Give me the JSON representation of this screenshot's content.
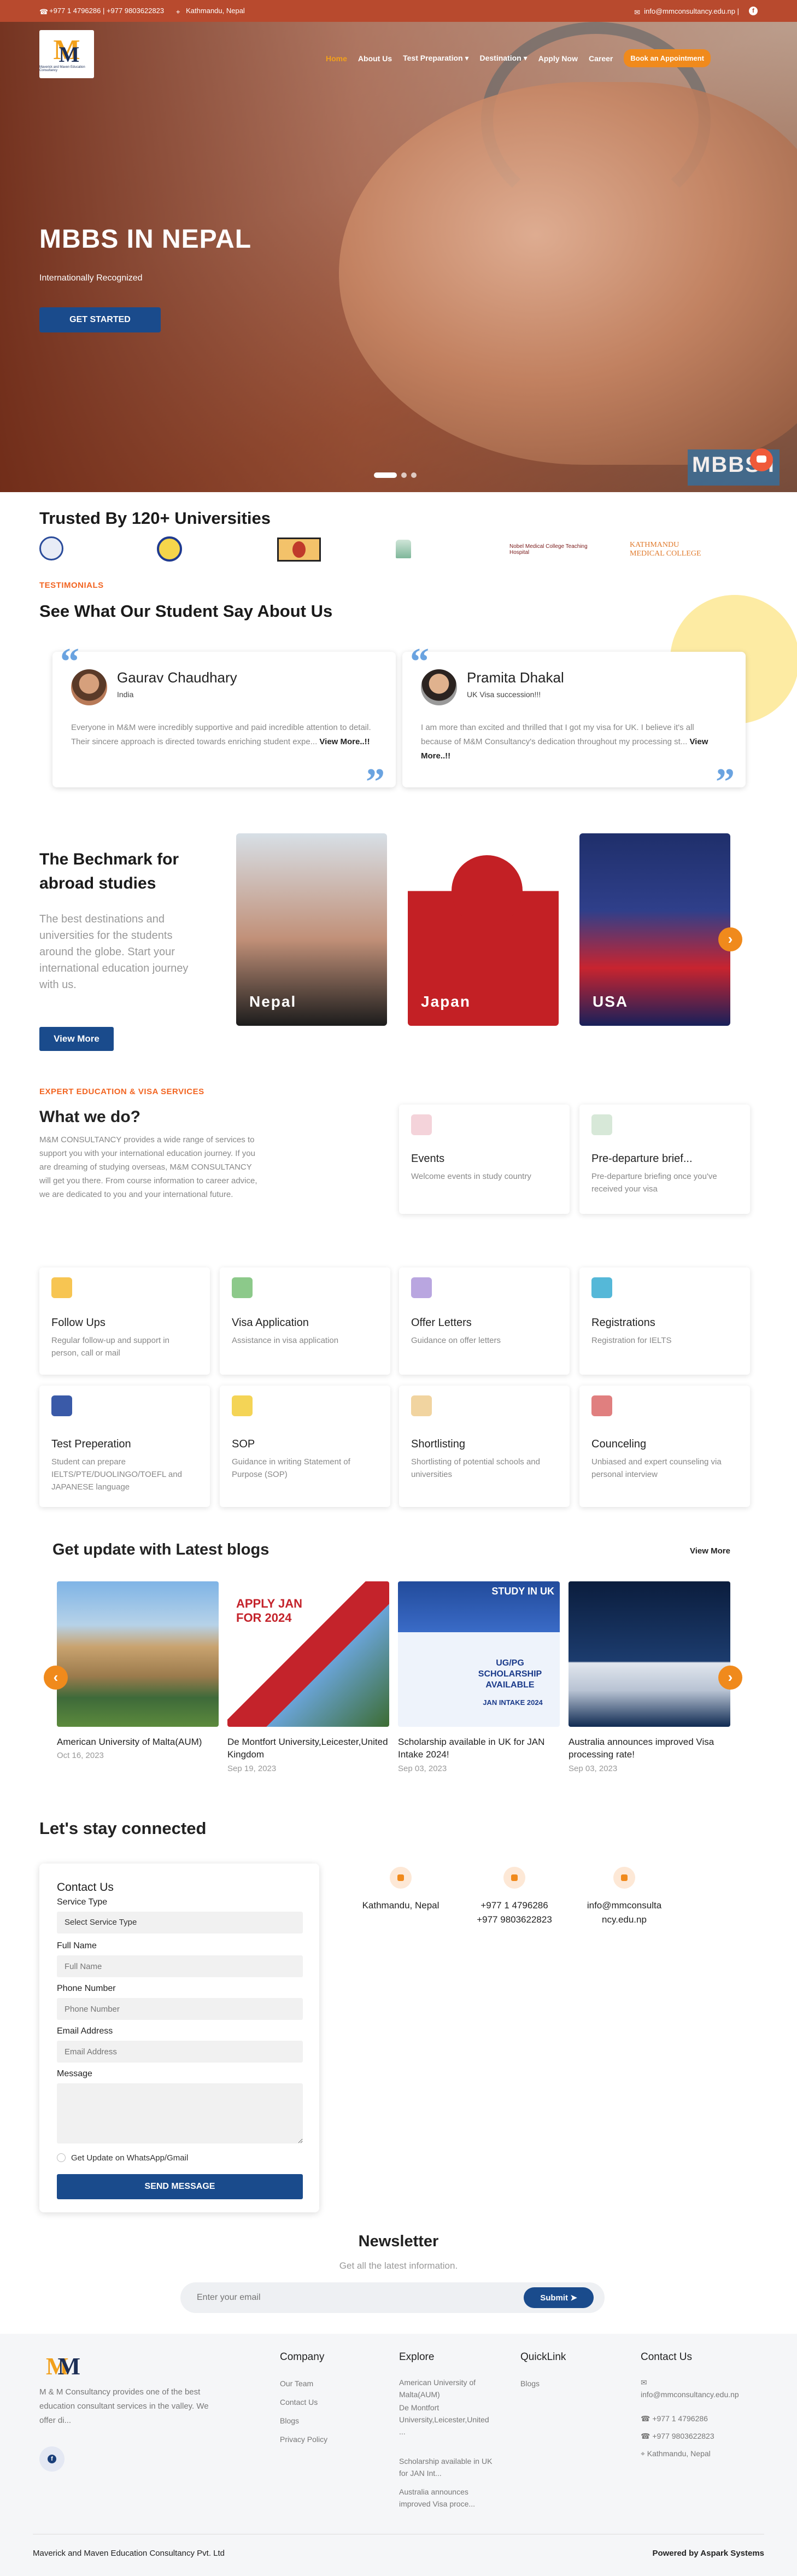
{
  "topbar": {
    "phone": "+977 1 4796286 | +977 9803622823",
    "location": "Kathmandu, Nepal",
    "email": "info@mmconsultancy.edu.np |"
  },
  "logo": {
    "text": "Maverick and Maven Education Consultancy"
  },
  "nav": {
    "items": [
      "Home",
      "About Us",
      "Test Preparation ▾",
      "Destination ▾",
      "Apply Now",
      "Career"
    ],
    "cta": "Book an Appointment"
  },
  "hero": {
    "title": "MBBS IN NEPAL",
    "subtitle": "Internationally Recognized",
    "cta": "GET STARTED",
    "badge": "MBBS I"
  },
  "trusted": {
    "title": "Trusted By 120+ Universities",
    "logos": [
      "Nobel Medical College Teaching Hospital",
      "KATHMANDU MEDICAL COLLEGE"
    ]
  },
  "testimonials": {
    "tag": "TESTIMONIALS",
    "title": "See What Our Student Say About Us",
    "items": [
      {
        "name": "Gaurav Chaudhary",
        "role": "India",
        "text": "Everyone in M&M were incredibly supportive and paid incredible attention to detail. Their sincere approach is directed towards enriching student expe...",
        "more": "View More..!!"
      },
      {
        "name": "Pramita Dhakal",
        "role": "UK Visa succession!!!",
        "text": "I am more than excited and thrilled that I got my visa for UK. I believe it's all because of M&M Consultancy's dedication throughout my processing st...",
        "more": "View More..!!"
      }
    ]
  },
  "benchmark": {
    "title": "The Bechmark for abroad studies",
    "desc": "The best destinations and universities for the students around the globe. Start your international education journey with us.",
    "cta": "View More",
    "destinations": [
      "Nepal",
      "Japan",
      "USA"
    ]
  },
  "services": {
    "tag": "EXPERT EDUCATION & VISA SERVICES",
    "title": "What we do?",
    "desc": "M&M CONSULTANCY provides a wide range of services to support you with your international education journey. If you are dreaming of studying overseas, M&M CONSULTANCY will get you there. From course information to career advice, we are dedicated to you and your international future.",
    "items": [
      {
        "title": "Events",
        "desc": "Welcome events in study country"
      },
      {
        "title": "Pre-departure brief...",
        "desc": "Pre-departure briefing once you've received your visa"
      },
      {
        "title": "Follow Ups",
        "desc": "Regular follow-up and support in person, call or mail"
      },
      {
        "title": "Visa Application",
        "desc": "Assistance in visa application"
      },
      {
        "title": "Offer Letters",
        "desc": "Guidance on offer letters"
      },
      {
        "title": "Registrations",
        "desc": "Registration for IELTS"
      },
      {
        "title": "Test Preperation",
        "desc": "Student can prepare IELTS/PTE/DUOLINGO/TOEFL and JAPANESE language"
      },
      {
        "title": "SOP",
        "desc": "Guidance in writing Statement of Purpose (SOP)"
      },
      {
        "title": "Shortlisting",
        "desc": "Shortlisting of potential schools and universities"
      },
      {
        "title": "Counceling",
        "desc": "Unbiased and expert counseling via personal interview"
      }
    ]
  },
  "blogs": {
    "title": "Get update with Latest blogs",
    "more": "View More",
    "items": [
      {
        "title": "American University of Malta(AUM)",
        "date": "Oct 16, 2023"
      },
      {
        "title": "De Montfort University,Leicester,United Kingdom",
        "date": "Sep 19, 2023"
      },
      {
        "title": "Scholarship available in UK for JAN Intake 2024!",
        "date": "Sep 03, 2023"
      },
      {
        "title": "Australia announces improved Visa processing rate!",
        "date": "Sep 03, 2023"
      }
    ],
    "b2_text": "APPLY JAN FOR 2024",
    "b3_text": "STUDY IN UK",
    "b3_sub": "UG/PG SCHOLARSHIP AVAILABLE",
    "b3_intake": "JAN INTAKE 2024"
  },
  "contact": {
    "title": "Let's stay connected",
    "form_title": "Contact Us",
    "fields": [
      {
        "label": "Service Type",
        "placeholder": "Select Service Type"
      },
      {
        "label": "Full Name",
        "placeholder": "Full Name"
      },
      {
        "label": "Phone Number",
        "placeholder": "Phone Number"
      },
      {
        "label": "Email Address",
        "placeholder": "Email Address"
      },
      {
        "label": "Message",
        "placeholder": ""
      }
    ],
    "checkbox": "Get Update on WhatsApp/Gmail",
    "submit": "SEND MESSAGE",
    "info": [
      "Kathmandu, Nepal",
      "+977 1 4796286 +977 9803622823",
      "info@mmconsultancy.edu.np"
    ]
  },
  "newsletter": {
    "title": "Newsletter",
    "subtitle": "Get all the latest information.",
    "placeholder": "Enter your email",
    "button": "Submit ➤"
  },
  "footer": {
    "about": "M & M Consultancy provides one of the best education consultant services in the valley. We offer di...",
    "company": {
      "title": "Company",
      "items": [
        "Our Team",
        "Contact Us",
        "Blogs",
        "Privacy Policy"
      ]
    },
    "explore": {
      "title": "Explore",
      "items": [
        "American University of Malta(AUM)",
        "De Montfort University,Leicester,United ...",
        "Scholarship available in UK for JAN Int...",
        "Australia announces improved Visa proce..."
      ]
    },
    "quicklink": {
      "title": "QuickLink",
      "items": [
        "Blogs"
      ]
    },
    "contact": {
      "title": "Contact Us",
      "items": [
        "info@mmconsultancy.edu.np",
        "+977 1 4796286",
        "+977 9803622823",
        "Kathmandu, Nepal"
      ]
    },
    "copyright": "Maverick and Maven Education Consultancy Pvt. Ltd",
    "powered_prefix": "Powered by ",
    "powered_by": "Aspark Systems"
  }
}
